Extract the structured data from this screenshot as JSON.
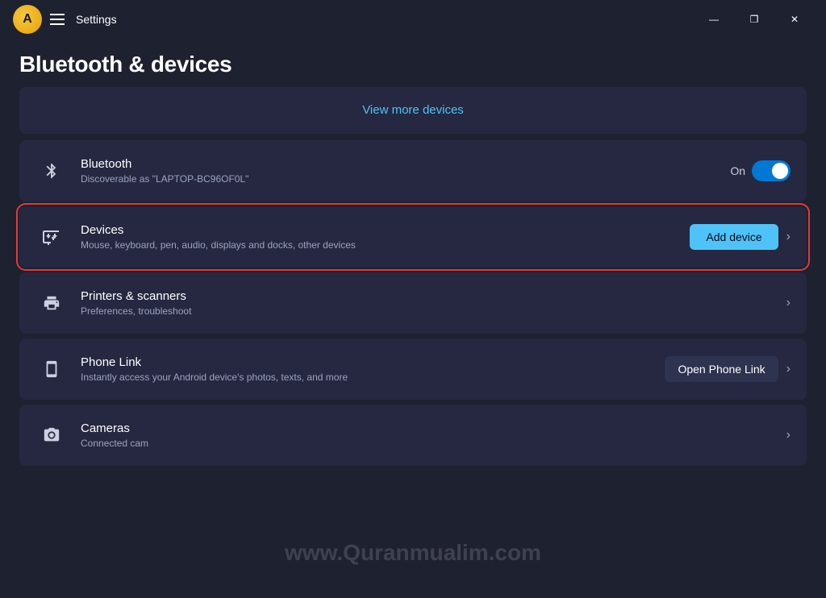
{
  "titlebar": {
    "title": "Settings",
    "minimize_label": "—",
    "maximize_label": "❐",
    "close_label": "✕"
  },
  "page": {
    "title": "Bluetooth & devices"
  },
  "view_more_banner": {
    "label": "View more devices"
  },
  "bluetooth_item": {
    "title": "Bluetooth",
    "subtitle": "Discoverable as \"LAPTOP-BC96OF0L\"",
    "toggle_label": "On",
    "toggle_state": true
  },
  "devices_item": {
    "title": "Devices",
    "subtitle": "Mouse, keyboard, pen, audio, displays and docks, other devices",
    "add_button_label": "Add device"
  },
  "printers_item": {
    "title": "Printers & scanners",
    "subtitle": "Preferences, troubleshoot"
  },
  "phone_link_item": {
    "title": "Phone Link",
    "subtitle": "Instantly access your Android device's photos, texts, and more",
    "open_button_label": "Open Phone Link"
  },
  "cameras_item": {
    "title": "Cameras",
    "subtitle": "Connected cam"
  },
  "watermark": {
    "text": "www.Quranmualim.com"
  }
}
